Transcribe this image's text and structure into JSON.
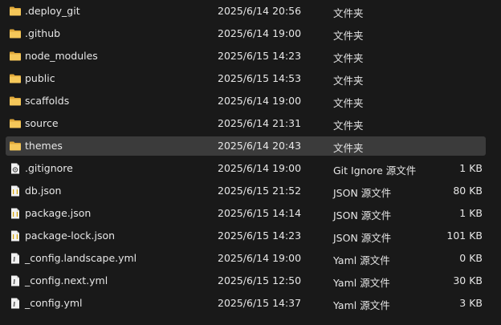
{
  "files": [
    {
      "name": ".deploy_git",
      "date": "2025/6/14 20:56",
      "type": "文件夹",
      "size": "",
      "icon": "folder-icon",
      "selected": false
    },
    {
      "name": ".github",
      "date": "2025/6/14 19:00",
      "type": "文件夹",
      "size": "",
      "icon": "folder-icon",
      "selected": false
    },
    {
      "name": "node_modules",
      "date": "2025/6/15 14:23",
      "type": "文件夹",
      "size": "",
      "icon": "folder-icon",
      "selected": false
    },
    {
      "name": "public",
      "date": "2025/6/15 14:53",
      "type": "文件夹",
      "size": "",
      "icon": "folder-icon",
      "selected": false
    },
    {
      "name": "scaffolds",
      "date": "2025/6/14 19:00",
      "type": "文件夹",
      "size": "",
      "icon": "folder-icon",
      "selected": false
    },
    {
      "name": "source",
      "date": "2025/6/14 21:31",
      "type": "文件夹",
      "size": "",
      "icon": "folder-icon",
      "selected": false
    },
    {
      "name": "themes",
      "date": "2025/6/14 20:43",
      "type": "文件夹",
      "size": "",
      "icon": "folder-icon",
      "selected": true
    },
    {
      "name": ".gitignore",
      "date": "2025/6/14 19:00",
      "type": "Git Ignore 源文件",
      "size": "1 KB",
      "icon": "gear-file-icon",
      "selected": false
    },
    {
      "name": "db.json",
      "date": "2025/6/15 21:52",
      "type": "JSON 源文件",
      "size": "80 KB",
      "icon": "json-file-icon",
      "selected": false
    },
    {
      "name": "package.json",
      "date": "2025/6/15 14:14",
      "type": "JSON 源文件",
      "size": "1 KB",
      "icon": "json-file-icon",
      "selected": false
    },
    {
      "name": "package-lock.json",
      "date": "2025/6/15 14:23",
      "type": "JSON 源文件",
      "size": "101 KB",
      "icon": "json-file-icon",
      "selected": false
    },
    {
      "name": "_config.landscape.yml",
      "date": "2025/6/14 19:00",
      "type": "Yaml 源文件",
      "size": "0 KB",
      "icon": "yaml-file-icon",
      "selected": false
    },
    {
      "name": "_config.next.yml",
      "date": "2025/6/15 12:50",
      "type": "Yaml 源文件",
      "size": "30 KB",
      "icon": "yaml-file-icon",
      "selected": false
    },
    {
      "name": "_config.yml",
      "date": "2025/6/15 14:37",
      "type": "Yaml 源文件",
      "size": "3 KB",
      "icon": "yaml-file-icon",
      "selected": false
    }
  ],
  "colors": {
    "background": "#191919",
    "selected_row": "#3b3b3b",
    "folder": "#f2c14e",
    "text": "#e6e6e6"
  }
}
